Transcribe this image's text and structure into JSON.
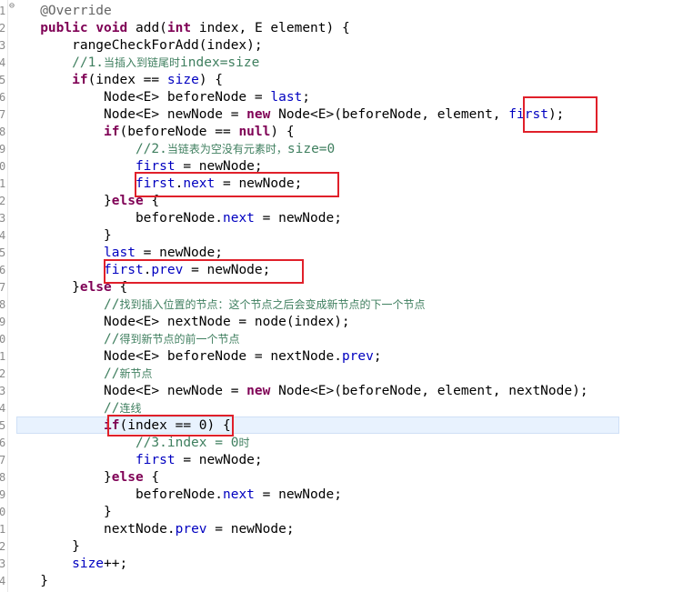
{
  "editor": {
    "gutter_numbers": [
      "1",
      "2",
      "3",
      "4",
      "5",
      "6",
      "7",
      "8",
      "9",
      "0",
      "1",
      "2",
      "3",
      "4",
      "5",
      "6",
      "7",
      "8",
      "9",
      "0",
      "1",
      "2",
      "3",
      "4",
      "5",
      "6",
      "7",
      "8",
      "9",
      "0",
      "1",
      "2",
      "3",
      "4"
    ],
    "current_line_highlight": "#e8f2fe",
    "highlight_box_color": "#e0202a",
    "lines": [
      {
        "i": "",
        "s": [
          [
            "ann",
            "@Override"
          ]
        ]
      },
      {
        "i": "",
        "s": [
          [
            "kw",
            "public"
          ],
          [
            "t",
            " "
          ],
          [
            "kw",
            "void"
          ],
          [
            "t",
            " add("
          ],
          [
            "kw",
            "int"
          ],
          [
            "t",
            " index, E element) {"
          ]
        ]
      },
      {
        "i": "    ",
        "s": [
          [
            "t",
            "rangeCheckForAdd(index);"
          ]
        ]
      },
      {
        "i": "    ",
        "s": [
          [
            "cm",
            "//1."
          ],
          [
            "cmcn",
            "当插入到链尾时"
          ],
          [
            "cm",
            "index=size"
          ]
        ]
      },
      {
        "i": "    ",
        "s": [
          [
            "kw",
            "if"
          ],
          [
            "t",
            "(index == "
          ],
          [
            "fld",
            "size"
          ],
          [
            "t",
            ") {"
          ]
        ]
      },
      {
        "i": "        ",
        "s": [
          [
            "t",
            "Node<E> beforeNode = "
          ],
          [
            "fld",
            "last"
          ],
          [
            "t",
            ";"
          ]
        ]
      },
      {
        "i": "        ",
        "s": [
          [
            "t",
            "Node<E> newNode = "
          ],
          [
            "kw",
            "new"
          ],
          [
            "t",
            " Node<E>(beforeNode, element, "
          ],
          [
            "fld",
            "first"
          ],
          [
            "t",
            ");"
          ]
        ]
      },
      {
        "i": "        ",
        "s": [
          [
            "kw",
            "if"
          ],
          [
            "t",
            "(beforeNode == "
          ],
          [
            "kw",
            "null"
          ],
          [
            "t",
            ") {"
          ]
        ]
      },
      {
        "i": "            ",
        "s": [
          [
            "cm",
            "//2."
          ],
          [
            "cmcn",
            "当链表为空没有元素时，"
          ],
          [
            "cm",
            "size=0"
          ]
        ]
      },
      {
        "i": "            ",
        "s": [
          [
            "fld",
            "first"
          ],
          [
            "t",
            " = newNode;"
          ]
        ]
      },
      {
        "i": "            ",
        "s": [
          [
            "fld",
            "first"
          ],
          [
            "t",
            "."
          ],
          [
            "fld",
            "next"
          ],
          [
            "t",
            " = newNode;"
          ]
        ]
      },
      {
        "i": "        ",
        "s": [
          [
            "t",
            "}"
          ],
          [
            "kw",
            "else"
          ],
          [
            "t",
            " {"
          ]
        ]
      },
      {
        "i": "            ",
        "s": [
          [
            "t",
            "beforeNode."
          ],
          [
            "fld",
            "next"
          ],
          [
            "t",
            " = newNode;"
          ]
        ]
      },
      {
        "i": "        ",
        "s": [
          [
            "t",
            "}"
          ]
        ]
      },
      {
        "i": "        ",
        "s": [
          [
            "fld",
            "last"
          ],
          [
            "t",
            " = newNode;"
          ]
        ]
      },
      {
        "i": "        ",
        "s": [
          [
            "fld",
            "first"
          ],
          [
            "t",
            "."
          ],
          [
            "fld",
            "prev"
          ],
          [
            "t",
            " = newNode;"
          ]
        ]
      },
      {
        "i": "    ",
        "s": [
          [
            "t",
            "}"
          ],
          [
            "kw",
            "else"
          ],
          [
            "t",
            " {"
          ]
        ]
      },
      {
        "i": "        ",
        "s": [
          [
            "cm",
            "//"
          ],
          [
            "cmcn",
            "找到插入位置的节点：这个节点之后会变成新节点的下一个节点"
          ]
        ]
      },
      {
        "i": "        ",
        "s": [
          [
            "t",
            "Node<E> nextNode = node(index);"
          ]
        ]
      },
      {
        "i": "        ",
        "s": [
          [
            "cm",
            "//"
          ],
          [
            "cmcn",
            "得到新节点的前一个节点"
          ]
        ]
      },
      {
        "i": "        ",
        "s": [
          [
            "t",
            "Node<E> beforeNode = nextNode."
          ],
          [
            "fld",
            "prev"
          ],
          [
            "t",
            ";"
          ]
        ]
      },
      {
        "i": "        ",
        "s": [
          [
            "cm",
            "//"
          ],
          [
            "cmcn",
            "新节点"
          ]
        ]
      },
      {
        "i": "        ",
        "s": [
          [
            "t",
            "Node<E> newNode = "
          ],
          [
            "kw",
            "new"
          ],
          [
            "t",
            " Node<E>(beforeNode, element, nextNode);"
          ]
        ]
      },
      {
        "i": "        ",
        "s": [
          [
            "cm",
            "//"
          ],
          [
            "cmcn",
            "连线"
          ]
        ]
      },
      {
        "i": "        ",
        "s": [
          [
            "kw",
            "if"
          ],
          [
            "t",
            "(index == 0) {"
          ]
        ]
      },
      {
        "i": "            ",
        "s": [
          [
            "cm",
            "//3.index = 0"
          ],
          [
            "cmcn",
            "时"
          ]
        ]
      },
      {
        "i": "            ",
        "s": [
          [
            "fld",
            "first"
          ],
          [
            "t",
            " = newNode;"
          ]
        ]
      },
      {
        "i": "        ",
        "s": [
          [
            "t",
            "}"
          ],
          [
            "kw",
            "else"
          ],
          [
            "t",
            " {"
          ]
        ]
      },
      {
        "i": "            ",
        "s": [
          [
            "t",
            "beforeNode."
          ],
          [
            "fld",
            "next"
          ],
          [
            "t",
            " = newNode;"
          ]
        ]
      },
      {
        "i": "        ",
        "s": [
          [
            "t",
            "}"
          ]
        ]
      },
      {
        "i": "        ",
        "s": [
          [
            "t",
            "nextNode."
          ],
          [
            "fld",
            "prev"
          ],
          [
            "t",
            " = newNode;"
          ]
        ]
      },
      {
        "i": "    ",
        "s": [
          [
            "t",
            "}"
          ]
        ]
      },
      {
        "i": "    ",
        "s": [
          [
            "fld",
            "size"
          ],
          [
            "t",
            "++;"
          ]
        ]
      },
      {
        "i": "",
        "s": [
          [
            "t",
            "}"
          ]
        ]
      }
    ]
  }
}
